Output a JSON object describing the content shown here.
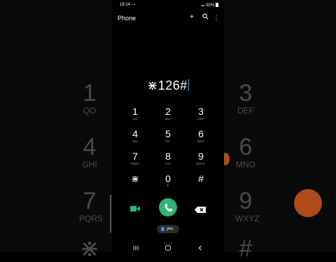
{
  "status": {
    "time": "18:14",
    "battery": "92%"
  },
  "appbar": {
    "title": "Phone"
  },
  "dialer": {
    "number": "⋇126#",
    "keys": [
      {
        "digit": "1",
        "letters": "QO"
      },
      {
        "digit": "2",
        "letters": "ABC"
      },
      {
        "digit": "3",
        "letters": "DEF"
      },
      {
        "digit": "4",
        "letters": "GHI"
      },
      {
        "digit": "5",
        "letters": "JKL"
      },
      {
        "digit": "6",
        "letters": "MNO"
      },
      {
        "digit": "7",
        "letters": "PQRS"
      },
      {
        "digit": "8",
        "letters": "TUV"
      },
      {
        "digit": "9",
        "letters": "WXYZ"
      },
      {
        "digit": "⋇",
        "letters": ""
      },
      {
        "digit": "0",
        "letters": "+"
      },
      {
        "digit": "#",
        "letters": ""
      }
    ]
  },
  "sim": {
    "slot": "1",
    "label": "yes"
  },
  "ghost": {
    "left": [
      {
        "digit": "1",
        "letters": "QO"
      },
      {
        "digit": "4",
        "letters": "GHI"
      },
      {
        "digit": "7",
        "letters": "PQRS"
      },
      {
        "digit": "⋇",
        "letters": ""
      }
    ],
    "right": [
      {
        "digit": "3",
        "letters": "DEF"
      },
      {
        "digit": "6",
        "letters": "MNO"
      },
      {
        "digit": "9",
        "letters": "WXYZ"
      },
      {
        "digit": "#",
        "letters": ""
      }
    ]
  },
  "colors": {
    "call": "#2bb673",
    "video": "#2bb673",
    "caret": "#4aa3ff",
    "sim": "#2a7de1"
  }
}
